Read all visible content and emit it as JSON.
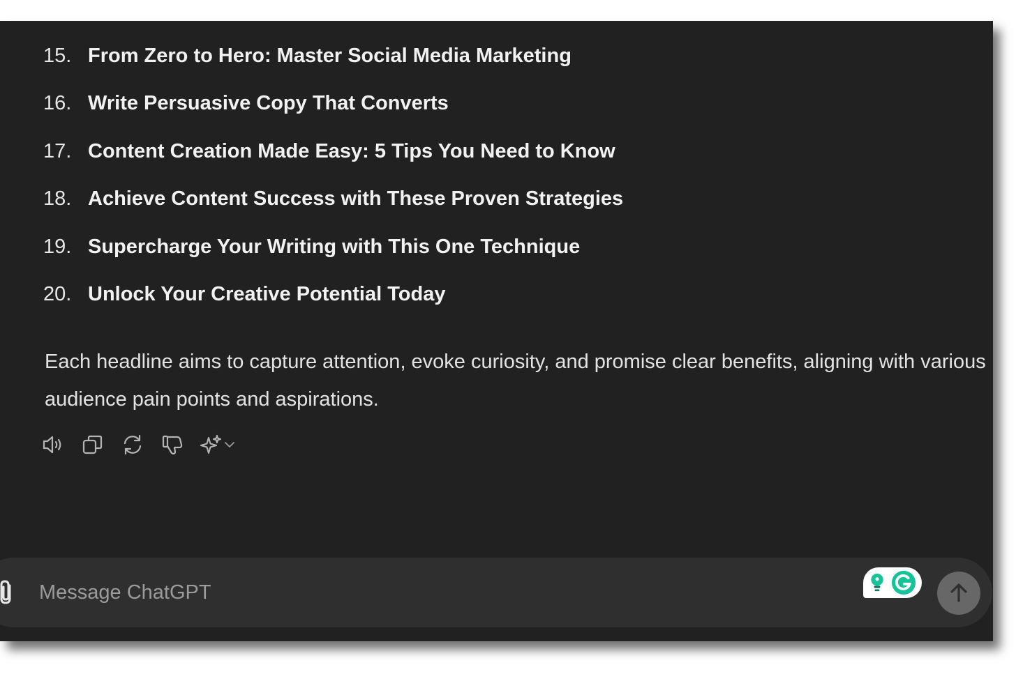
{
  "list": [
    {
      "number": "15.",
      "text": "From Zero to Hero: Master Social Media Marketing"
    },
    {
      "number": "16.",
      "text": "Write Persuasive Copy That Converts"
    },
    {
      "number": "17.",
      "text": "Content Creation Made Easy: 5 Tips You Need to Know"
    },
    {
      "number": "18.",
      "text": "Achieve Content Success with These Proven Strategies"
    },
    {
      "number": "19.",
      "text": "Supercharge Your Writing with This One Technique"
    },
    {
      "number": "20.",
      "text": "Unlock Your Creative Potential Today"
    }
  ],
  "summary": "Each headline aims to capture attention, evoke curiosity, and promise clear benefits, aligning with various audience pain points and aspirations.",
  "actions": {
    "icons": [
      "speaker-icon",
      "copy-icon",
      "regenerate-icon",
      "thumbs-down-icon",
      "sparkle-icon",
      "chevron-down-icon"
    ]
  },
  "composer": {
    "placeholder": "Message ChatGPT",
    "value": ""
  },
  "colors": {
    "background": "#212121",
    "composer": "#2f2f2f",
    "send_button": "#676767",
    "grammarly_green": "#15c39a",
    "grammarly_dark_green": "#0f7a5f"
  }
}
